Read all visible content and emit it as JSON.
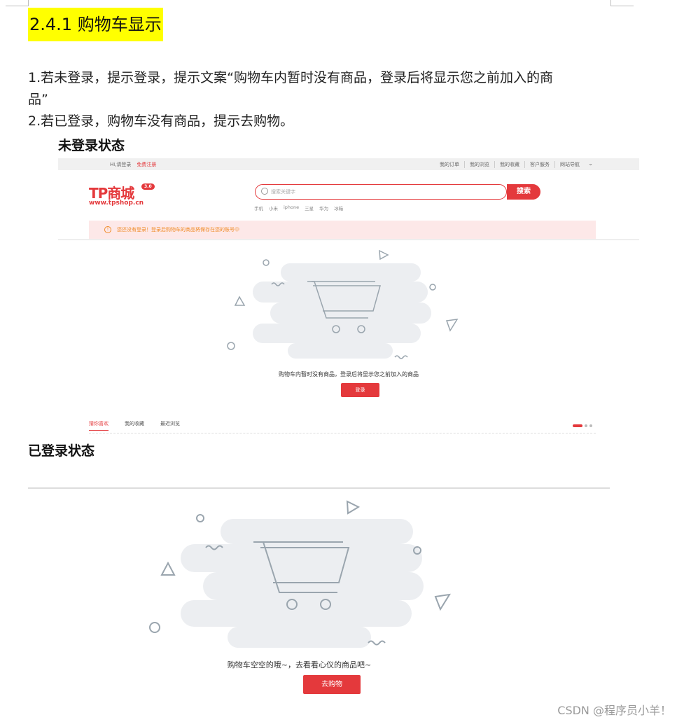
{
  "heading": "2.4.1  购物车显示",
  "paragraphs": [
    "1.若未登录，提示登录，提示文案“购物车内暂时没有商品，登录后将显示您之前加入的商",
    "品”",
    "2.若已登录，购物车没有商品，提示去购物。"
  ],
  "section1_label": "未登录状态",
  "section2_label": "已登录状态",
  "shot1": {
    "topbar_left_hi": "Hi,请登录",
    "topbar_left_register": "免费注册",
    "topbar_right": [
      "我的订单",
      "我的浏览",
      "我的收藏",
      "客户服务",
      "网站导航"
    ],
    "logo": "TP商城",
    "logo_version": "3.0",
    "logo_url": "www.tpshop.cn",
    "search_placeholder": "搜索关键字",
    "search_button": "搜索",
    "hot_words": [
      "手机",
      "小米",
      "iphone",
      "三星",
      "华为",
      "冰箱"
    ],
    "notice": "您还没有登录！登录后购物车的商品将保存在您的账号中",
    "empty_text": "购物车内暂时没有商品，登录后将显示您之前加入的商品",
    "login_button": "登录",
    "tabs": [
      "猜你喜欢",
      "我的收藏",
      "最近浏览"
    ]
  },
  "shot2": {
    "empty_text": "购物车空空的哦~，去看看心仪的商品吧~",
    "go_button": "去购物"
  },
  "watermark": "CSDN @程序员小羊！",
  "colors": {
    "accent": "#e4393c",
    "highlight": "#ffff00",
    "notice_bg": "#fde8e8",
    "art_gray": "#eceef1"
  }
}
